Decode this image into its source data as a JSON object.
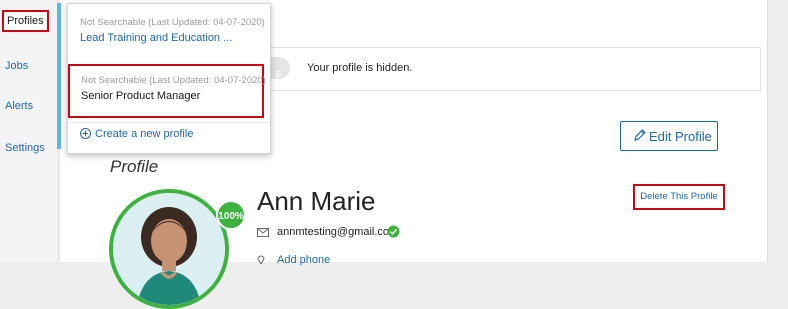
{
  "sidebar": {
    "items": [
      {
        "label": "Profiles"
      },
      {
        "label": "Jobs"
      },
      {
        "label": "Alerts"
      },
      {
        "label": "Settings"
      }
    ]
  },
  "profiles_dropdown": {
    "items": [
      {
        "status": "Not Searchable (Last Updated: 04-07-2020)",
        "title": "Lead Training and Education ..."
      },
      {
        "status": "Not Searchable (Last Updated: 04-07-2020)",
        "title": "Senior Product Manager"
      }
    ],
    "create_label": "Create a new profile"
  },
  "visibility": {
    "toggle_label": "F",
    "message": "Your profile is hidden."
  },
  "profile": {
    "heading": "Profile",
    "edit_label": "Edit Profile",
    "delete_label": "Delete This Profile",
    "completion": "100%",
    "name": "Ann Marie",
    "email": "annmtesting@gmail.com",
    "add_phone_label": "Add phone"
  },
  "colors": {
    "accent_blue": "#1e67a8",
    "highlight_red": "#c40b14",
    "success_green": "#3eb23e",
    "dropdown_accent": "#5bb4ea"
  },
  "icons": {
    "edit": "pencil-icon",
    "email": "envelope-icon",
    "verified": "check-circle-icon",
    "phone": "location-pin-icon",
    "create": "plus-circle-icon"
  }
}
